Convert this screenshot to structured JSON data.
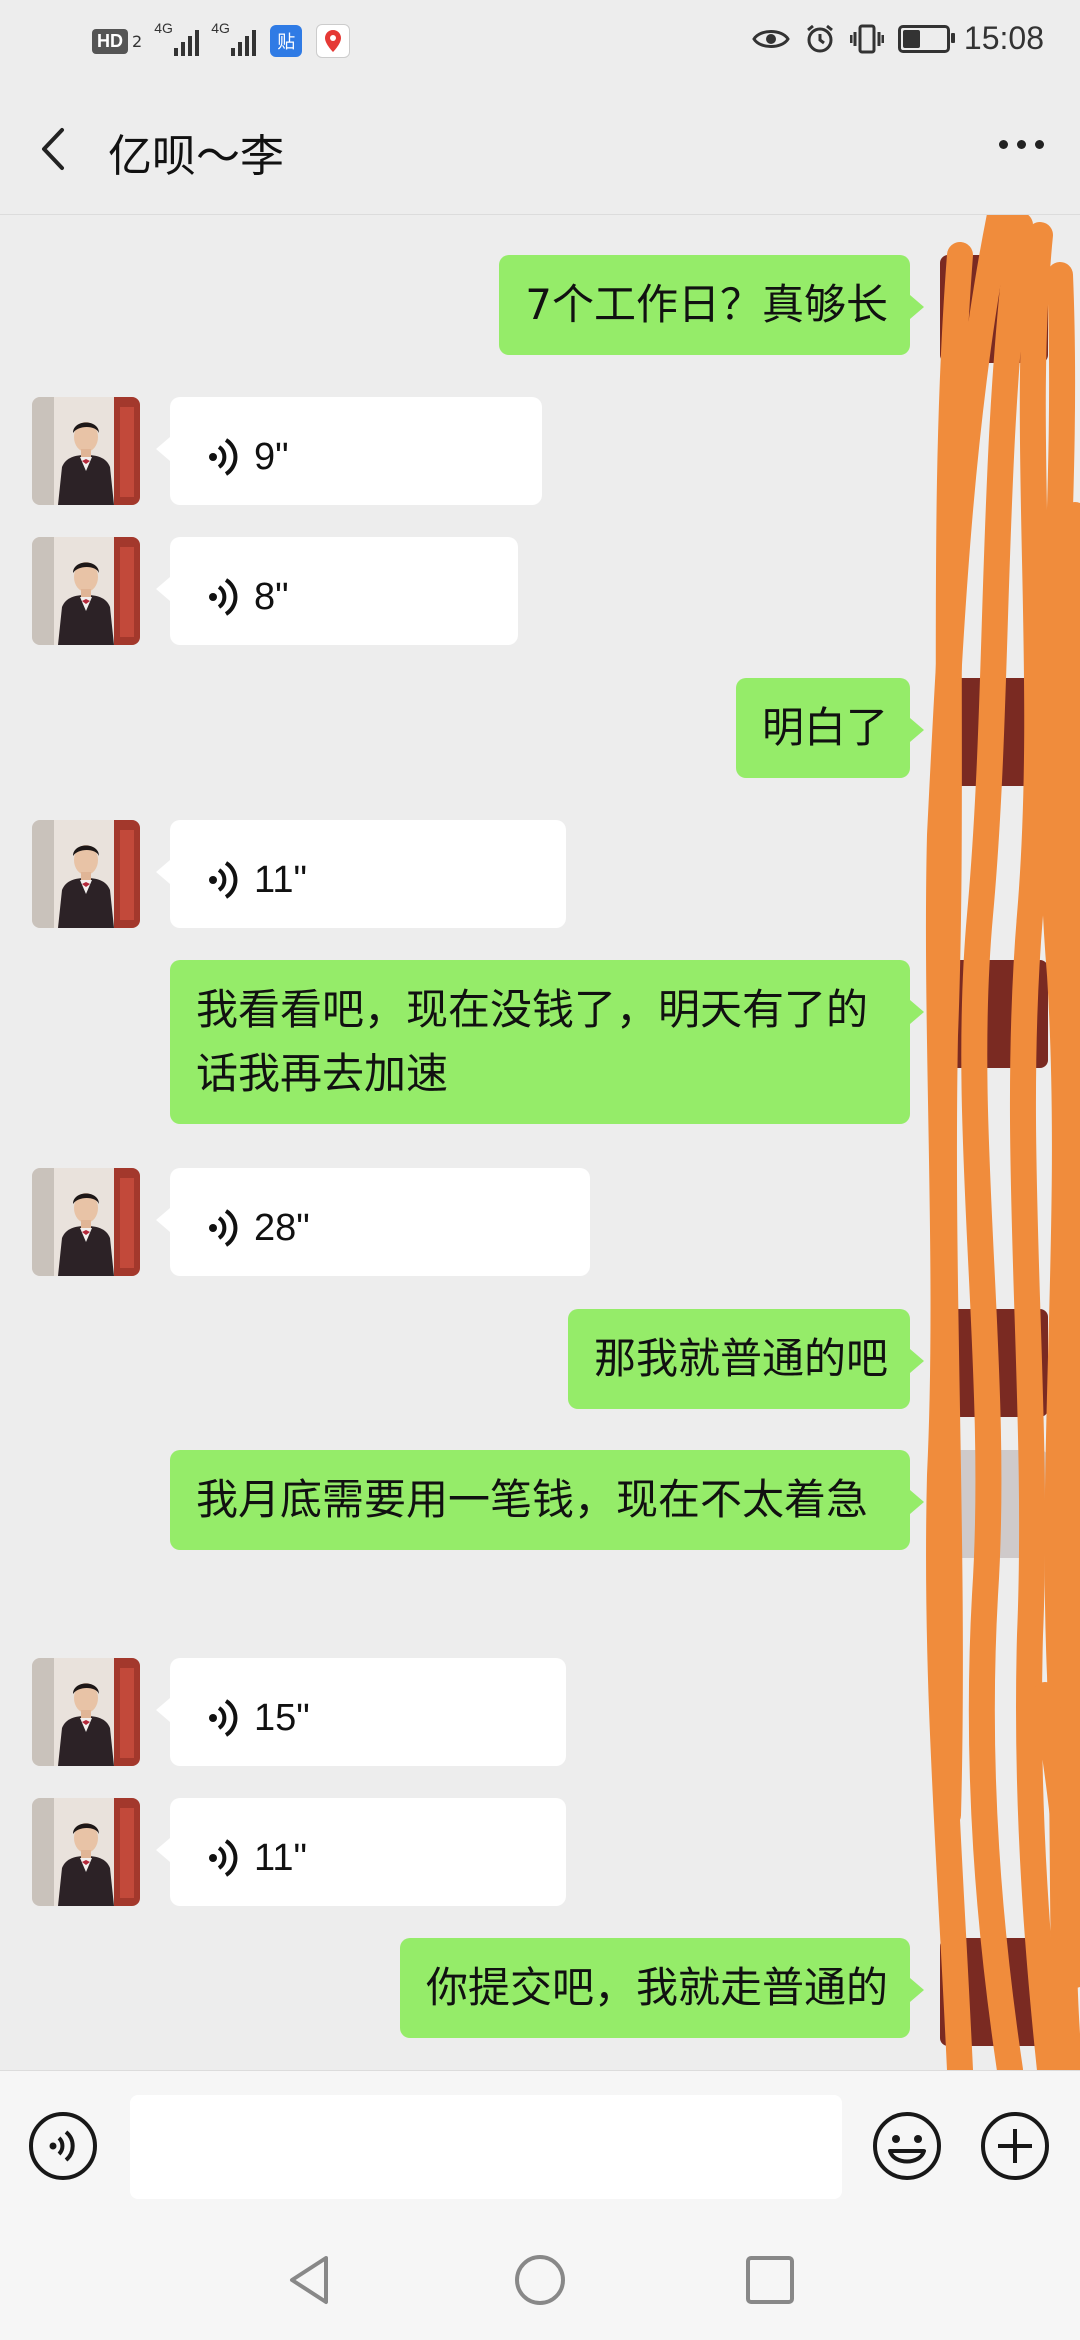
{
  "status_bar": {
    "left_badges": [
      "HD",
      "2"
    ],
    "network_1": "4G",
    "network_2": "4G",
    "app_icon_glyph": "贴",
    "time": "15:08",
    "battery_level": 0.45
  },
  "header": {
    "title": "亿呗～李"
  },
  "messages": [
    {
      "dir": "out",
      "type": "text",
      "text": "7个工作日？真够长"
    },
    {
      "dir": "in",
      "type": "voice",
      "duration": "9\""
    },
    {
      "dir": "in",
      "type": "voice",
      "duration": "8\""
    },
    {
      "dir": "out",
      "type": "text",
      "text": "明白了"
    },
    {
      "dir": "in",
      "type": "voice",
      "duration": "11\""
    },
    {
      "dir": "out",
      "type": "text",
      "text": "我看看吧，现在没钱了，明天有了的话我再去加速"
    },
    {
      "dir": "in",
      "type": "voice",
      "duration": "28\""
    },
    {
      "dir": "out",
      "type": "text",
      "text": "那我就普通的吧"
    },
    {
      "dir": "out",
      "type": "text",
      "text": "我月底需要用一笔钱，现在不太着急"
    },
    {
      "dir": "in",
      "type": "voice",
      "duration": "15\""
    },
    {
      "dir": "in",
      "type": "voice",
      "duration": "11\""
    },
    {
      "dir": "out",
      "type": "text",
      "text": "你提交吧，我就走普通的"
    }
  ],
  "input_bar": {
    "value": "",
    "icons": [
      "voice-icon",
      "emoji-icon",
      "plus-icon"
    ]
  },
  "nav_bar": {
    "icons": [
      "back-triangle-icon",
      "home-circle-icon",
      "recents-square-icon"
    ]
  },
  "colors": {
    "background": "#ededed",
    "outgoing_bubble": "#95ec69",
    "incoming_bubble": "#ffffff",
    "scribble": "#f08c3c"
  }
}
